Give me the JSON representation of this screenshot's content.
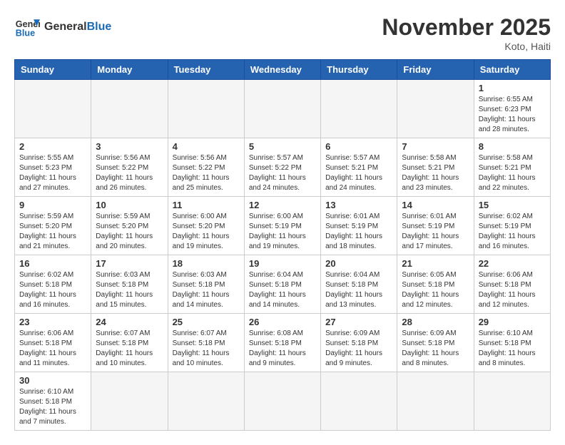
{
  "header": {
    "logo_general": "General",
    "logo_blue": "Blue",
    "month_title": "November 2025",
    "location": "Koto, Haiti"
  },
  "weekdays": [
    "Sunday",
    "Monday",
    "Tuesday",
    "Wednesday",
    "Thursday",
    "Friday",
    "Saturday"
  ],
  "weeks": [
    [
      {
        "day": "",
        "info": ""
      },
      {
        "day": "",
        "info": ""
      },
      {
        "day": "",
        "info": ""
      },
      {
        "day": "",
        "info": ""
      },
      {
        "day": "",
        "info": ""
      },
      {
        "day": "",
        "info": ""
      },
      {
        "day": "1",
        "info": "Sunrise: 6:55 AM\nSunset: 6:23 PM\nDaylight: 11 hours\nand 28 minutes."
      }
    ],
    [
      {
        "day": "2",
        "info": "Sunrise: 5:55 AM\nSunset: 5:23 PM\nDaylight: 11 hours\nand 27 minutes."
      },
      {
        "day": "3",
        "info": "Sunrise: 5:56 AM\nSunset: 5:22 PM\nDaylight: 11 hours\nand 26 minutes."
      },
      {
        "day": "4",
        "info": "Sunrise: 5:56 AM\nSunset: 5:22 PM\nDaylight: 11 hours\nand 25 minutes."
      },
      {
        "day": "5",
        "info": "Sunrise: 5:57 AM\nSunset: 5:22 PM\nDaylight: 11 hours\nand 24 minutes."
      },
      {
        "day": "6",
        "info": "Sunrise: 5:57 AM\nSunset: 5:21 PM\nDaylight: 11 hours\nand 24 minutes."
      },
      {
        "day": "7",
        "info": "Sunrise: 5:58 AM\nSunset: 5:21 PM\nDaylight: 11 hours\nand 23 minutes."
      },
      {
        "day": "8",
        "info": "Sunrise: 5:58 AM\nSunset: 5:21 PM\nDaylight: 11 hours\nand 22 minutes."
      }
    ],
    [
      {
        "day": "9",
        "info": "Sunrise: 5:59 AM\nSunset: 5:20 PM\nDaylight: 11 hours\nand 21 minutes."
      },
      {
        "day": "10",
        "info": "Sunrise: 5:59 AM\nSunset: 5:20 PM\nDaylight: 11 hours\nand 20 minutes."
      },
      {
        "day": "11",
        "info": "Sunrise: 6:00 AM\nSunset: 5:20 PM\nDaylight: 11 hours\nand 19 minutes."
      },
      {
        "day": "12",
        "info": "Sunrise: 6:00 AM\nSunset: 5:19 PM\nDaylight: 11 hours\nand 19 minutes."
      },
      {
        "day": "13",
        "info": "Sunrise: 6:01 AM\nSunset: 5:19 PM\nDaylight: 11 hours\nand 18 minutes."
      },
      {
        "day": "14",
        "info": "Sunrise: 6:01 AM\nSunset: 5:19 PM\nDaylight: 11 hours\nand 17 minutes."
      },
      {
        "day": "15",
        "info": "Sunrise: 6:02 AM\nSunset: 5:19 PM\nDaylight: 11 hours\nand 16 minutes."
      }
    ],
    [
      {
        "day": "16",
        "info": "Sunrise: 6:02 AM\nSunset: 5:18 PM\nDaylight: 11 hours\nand 16 minutes."
      },
      {
        "day": "17",
        "info": "Sunrise: 6:03 AM\nSunset: 5:18 PM\nDaylight: 11 hours\nand 15 minutes."
      },
      {
        "day": "18",
        "info": "Sunrise: 6:03 AM\nSunset: 5:18 PM\nDaylight: 11 hours\nand 14 minutes."
      },
      {
        "day": "19",
        "info": "Sunrise: 6:04 AM\nSunset: 5:18 PM\nDaylight: 11 hours\nand 14 minutes."
      },
      {
        "day": "20",
        "info": "Sunrise: 6:04 AM\nSunset: 5:18 PM\nDaylight: 11 hours\nand 13 minutes."
      },
      {
        "day": "21",
        "info": "Sunrise: 6:05 AM\nSunset: 5:18 PM\nDaylight: 11 hours\nand 12 minutes."
      },
      {
        "day": "22",
        "info": "Sunrise: 6:06 AM\nSunset: 5:18 PM\nDaylight: 11 hours\nand 12 minutes."
      }
    ],
    [
      {
        "day": "23",
        "info": "Sunrise: 6:06 AM\nSunset: 5:18 PM\nDaylight: 11 hours\nand 11 minutes."
      },
      {
        "day": "24",
        "info": "Sunrise: 6:07 AM\nSunset: 5:18 PM\nDaylight: 11 hours\nand 10 minutes."
      },
      {
        "day": "25",
        "info": "Sunrise: 6:07 AM\nSunset: 5:18 PM\nDaylight: 11 hours\nand 10 minutes."
      },
      {
        "day": "26",
        "info": "Sunrise: 6:08 AM\nSunset: 5:18 PM\nDaylight: 11 hours\nand 9 minutes."
      },
      {
        "day": "27",
        "info": "Sunrise: 6:09 AM\nSunset: 5:18 PM\nDaylight: 11 hours\nand 9 minutes."
      },
      {
        "day": "28",
        "info": "Sunrise: 6:09 AM\nSunset: 5:18 PM\nDaylight: 11 hours\nand 8 minutes."
      },
      {
        "day": "29",
        "info": "Sunrise: 6:10 AM\nSunset: 5:18 PM\nDaylight: 11 hours\nand 8 minutes."
      }
    ],
    [
      {
        "day": "30",
        "info": "Sunrise: 6:10 AM\nSunset: 5:18 PM\nDaylight: 11 hours\nand 7 minutes."
      },
      {
        "day": "",
        "info": ""
      },
      {
        "day": "",
        "info": ""
      },
      {
        "day": "",
        "info": ""
      },
      {
        "day": "",
        "info": ""
      },
      {
        "day": "",
        "info": ""
      },
      {
        "day": "",
        "info": ""
      }
    ]
  ]
}
